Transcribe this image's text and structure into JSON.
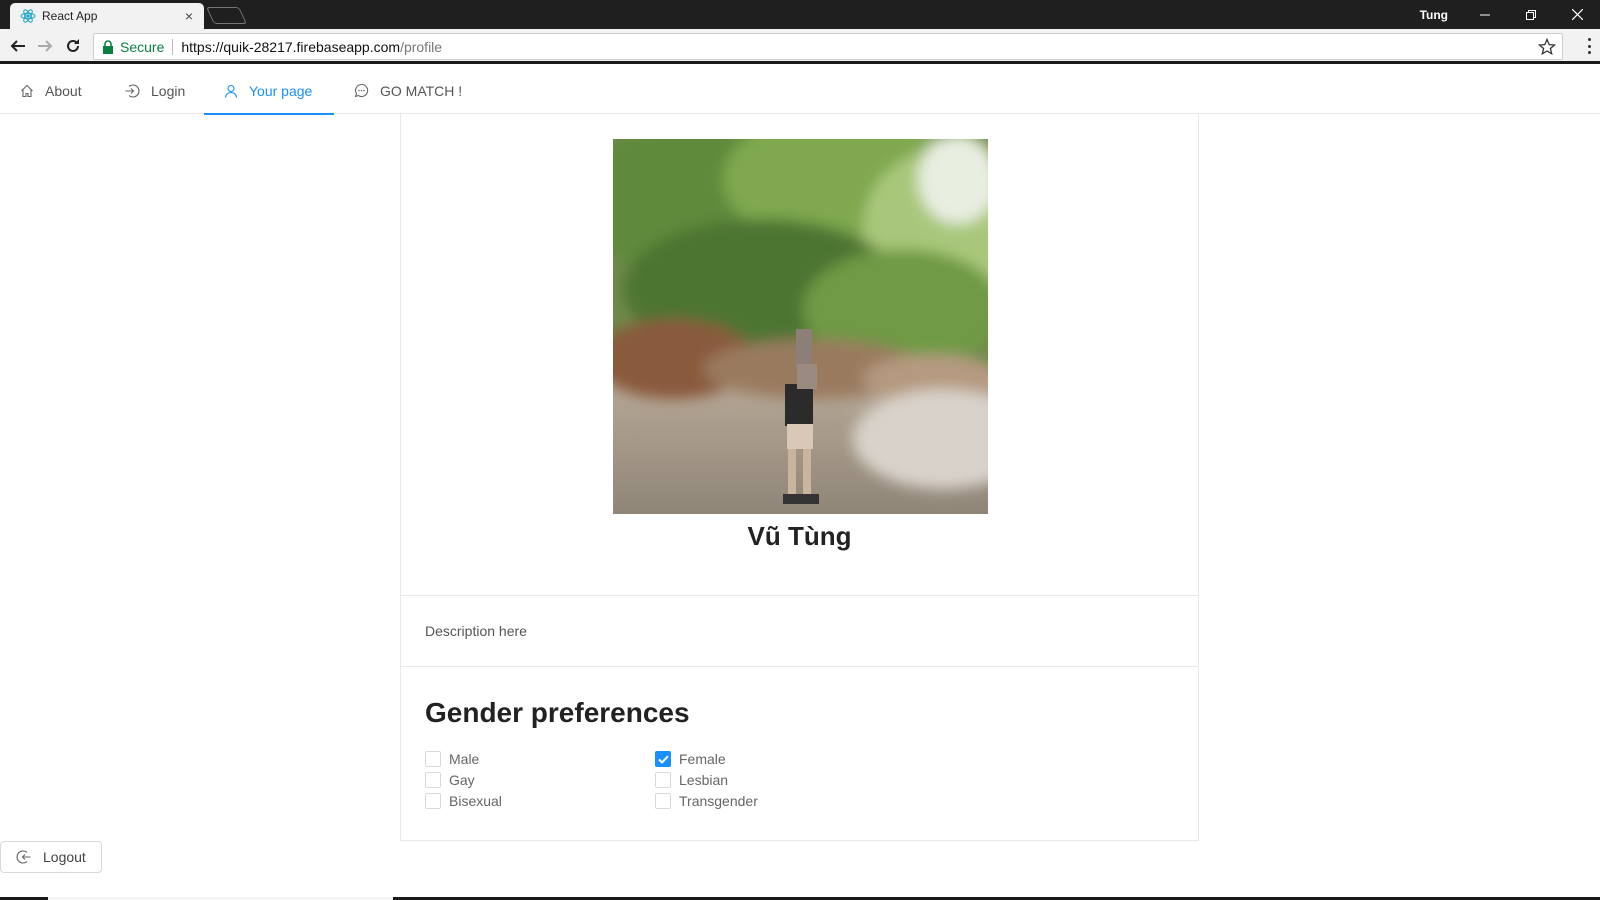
{
  "browser": {
    "tab_title": "React App",
    "tab_close": "×",
    "profile_name": "Tung",
    "secure_label": "Secure",
    "url_host": "https://quik-28217.firebaseapp.com",
    "url_path": "/profile"
  },
  "nav": {
    "items": [
      {
        "label": "About",
        "icon": "home-icon"
      },
      {
        "label": "Login",
        "icon": "login-icon"
      },
      {
        "label": "Your page",
        "icon": "user-icon",
        "active": true
      },
      {
        "label": "GO MATCH !",
        "icon": "message-icon"
      }
    ]
  },
  "profile": {
    "name": "Vũ Tùng",
    "description": "Description here"
  },
  "preferences": {
    "title": "Gender preferences",
    "options": [
      {
        "label": "Male",
        "checked": false
      },
      {
        "label": "Female",
        "checked": true
      },
      {
        "label": "Gay",
        "checked": false
      },
      {
        "label": "Lesbian",
        "checked": false
      },
      {
        "label": "Bisexual",
        "checked": false
      },
      {
        "label": "Transgender",
        "checked": false
      }
    ]
  },
  "logout_label": "Logout",
  "colors": {
    "accent": "#1890ff",
    "secure_green": "#0b8043",
    "titlebar": "#1f1f1f"
  }
}
